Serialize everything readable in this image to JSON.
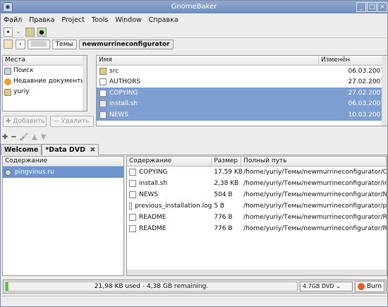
{
  "window": {
    "title": "GnomeBaker"
  },
  "menu": [
    "Файл",
    "Правка",
    "Project",
    "Tools",
    "Window",
    "Справка"
  ],
  "pathbar": {
    "segment1": "Темы",
    "segment2": "newmurrineconfigurator"
  },
  "places": {
    "header": "Места",
    "items": [
      "Поиск",
      "Недавние документы",
      "yuriy"
    ],
    "add_label": "Добавить",
    "remove_label": "Удалить"
  },
  "filebrowser": {
    "col_name": "Имя",
    "col_date": "Изменён",
    "rows": [
      {
        "name": "src",
        "date": "06.03.2007",
        "selected": false,
        "icon": "folder-icon"
      },
      {
        "name": "AUTHORS",
        "date": "27.02.2007",
        "selected": false,
        "icon": "file-icon"
      },
      {
        "name": "COPYING",
        "date": "27.02.2007",
        "selected": true,
        "icon": "file-icon"
      },
      {
        "name": "install.sh",
        "date": "06.03.2007",
        "selected": true,
        "icon": "script-icon"
      },
      {
        "name": "NEWS",
        "date": "10.03.2007",
        "selected": true,
        "icon": "file-icon"
      }
    ]
  },
  "tabs": [
    "Welcome",
    "*Data DVD"
  ],
  "contents": {
    "header": "Содержание",
    "item": "pingvinus.ru"
  },
  "disc": {
    "col_contents": "Содержание",
    "col_size": "Размер",
    "col_path": "Полный путь",
    "rows": [
      {
        "name": "COPYING",
        "size": "17,59 KB",
        "path": "/home/yuriy/Темы/newmurrineconfigurator/CO"
      },
      {
        "name": "install.sh",
        "size": "2,38 KB",
        "path": "/home/yuriy/Темы/newmurrineconfigurator/ins"
      },
      {
        "name": "NEWS",
        "size": "504 B",
        "path": "/home/yuriy/Темы/newmurrineconfigurator/NE"
      },
      {
        "name": "previous_installation.log",
        "size": "5 B",
        "path": "/home/yuriy/Темы/newmurrineconfigurator/pre"
      },
      {
        "name": "README",
        "size": "776 B",
        "path": "/home/yuriy/Темы/newmurrineconfigurator/RE"
      },
      {
        "name": "README",
        "size": "776 B",
        "path": "/home/yuriy/Темы/newmurrineconfigurator/RE"
      }
    ]
  },
  "status": {
    "usage": "21,98 KB used - 4,38 GB remaining.",
    "disc_type": "4.7GB DVD",
    "burn_label": "Burn",
    "used_fraction": 0.005
  }
}
